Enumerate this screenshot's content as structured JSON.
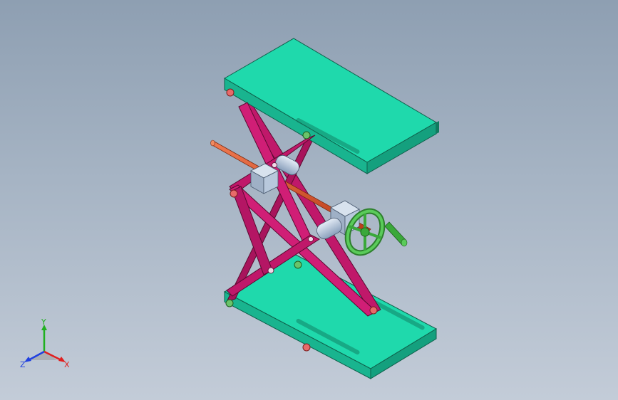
{
  "viewport": {
    "background_top": "#8e9fb2",
    "background_bottom": "#c3ccd8"
  },
  "model": {
    "name_icon": "scissor-lift-table-model",
    "colors": {
      "plate": "#1fd9ac",
      "plate_edge": "#0f5f4a",
      "arm": "#c0186a",
      "arm_edge": "#5a0a30",
      "rod": "#e0522a",
      "handwheel": "#3aa83a",
      "block": "#b8c8dc",
      "pin_red": "#e86a6a",
      "pin_green": "#6ac36a"
    }
  },
  "triad": {
    "x_label": "X",
    "y_label": "Y",
    "z_label": "Z",
    "x_color": "#e02020",
    "y_color": "#20b020",
    "z_color": "#2040e0"
  }
}
